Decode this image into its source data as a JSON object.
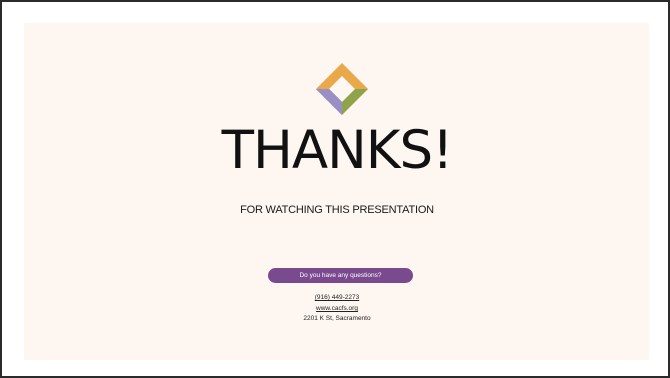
{
  "slide": {
    "title": "THANKS!",
    "subtitle": "FOR WATCHING THIS PRESENTATION",
    "cta_label": "Do you have any questions?",
    "phone": "(916) 449-2273",
    "website": "www.cacfs.org",
    "address": "2201 K St, Sacramento"
  },
  "colors": {
    "slide_background": "#fdf6f1",
    "cta_background": "#7a4a8e",
    "logo_top": "#e9a84a",
    "logo_right": "#8fa34a",
    "logo_bottom": "#6b4f8c",
    "logo_left": "#9a8fc4"
  },
  "icons": {
    "logo": "diamond-logo-icon"
  }
}
